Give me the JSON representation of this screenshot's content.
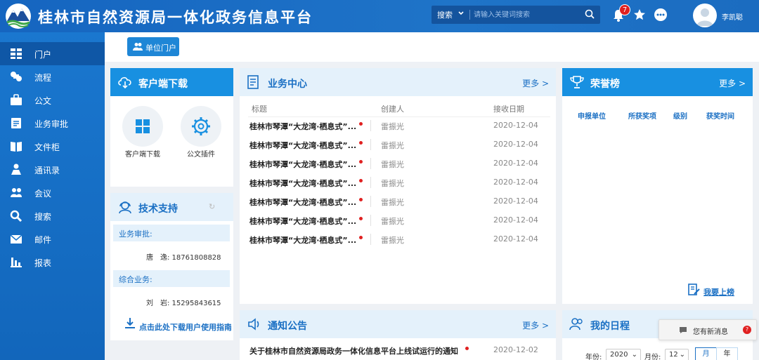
{
  "header": {
    "title": "桂林市自然资源局一体化政务信息平台",
    "search_type": "搜索",
    "search_placeholder": "请输入关键词搜索",
    "notification_count": "7",
    "user_name": "李凯聪"
  },
  "colors": {
    "header_bg": "#1a6fc4",
    "sidebar_bg": "#1a77cf",
    "accent": "#1890e1",
    "badge_red": "#e02020"
  },
  "sidebar": {
    "items": [
      {
        "label": "门户",
        "icon": "grid-icon"
      },
      {
        "label": "流程",
        "icon": "flow-icon"
      },
      {
        "label": "公文",
        "icon": "briefcase-icon"
      },
      {
        "label": "业务审批",
        "icon": "clipboard-icon"
      },
      {
        "label": "文件柜",
        "icon": "book-icon"
      },
      {
        "label": "通讯录",
        "icon": "contact-icon"
      },
      {
        "label": "会议",
        "icon": "meeting-icon"
      },
      {
        "label": "搜索",
        "icon": "search-icon"
      },
      {
        "label": "邮件",
        "icon": "mail-icon"
      },
      {
        "label": "报表",
        "icon": "chart-icon"
      }
    ]
  },
  "action_bar": {
    "unit_portal_label": "单位门户"
  },
  "download_card": {
    "title": "客户端下载",
    "items": [
      {
        "label": "客户端下载",
        "icon": "windows-icon"
      },
      {
        "label": "公文插件",
        "icon": "gear-icon"
      }
    ]
  },
  "support_card": {
    "title": "技术支持",
    "sections": [
      {
        "heading": "业务审批:",
        "contact": "唐　逸: 18761808828"
      },
      {
        "heading": "综合业务:",
        "contact": "刘　岩: 15295843615"
      }
    ],
    "manual_link": "点击此处下载用户使用指南"
  },
  "business_center": {
    "title": "业务中心",
    "more": "更多 >",
    "columns": [
      "标题",
      "创建人",
      "接收日期"
    ],
    "rows": [
      {
        "title": "桂林市琴潭“大龙湾·栖息式”...",
        "creator": "雷振光",
        "date": "2020-12-04"
      },
      {
        "title": "桂林市琴潭“大龙湾·栖息式”...",
        "creator": "雷振光",
        "date": "2020-12-04"
      },
      {
        "title": "桂林市琴潭“大龙湾·栖息式”...",
        "creator": "雷振光",
        "date": "2020-12-04"
      },
      {
        "title": "桂林市琴潭“大龙湾·栖息式”...",
        "creator": "雷振光",
        "date": "2020-12-04"
      },
      {
        "title": "桂林市琴潭“大龙湾·栖息式”...",
        "creator": "雷振光",
        "date": "2020-12-04"
      },
      {
        "title": "桂林市琴潭“大龙湾·栖息式”...",
        "creator": "雷振光",
        "date": "2020-12-04"
      },
      {
        "title": "桂林市琴潭“大龙湾·栖息式”...",
        "creator": "雷振光",
        "date": "2020-12-04"
      }
    ]
  },
  "honor_board": {
    "title": "荣誉榜",
    "more": "更多 >",
    "columns": [
      "申报单位",
      "所获奖项",
      "级别",
      "获奖时间"
    ],
    "upload_label": "我要上榜"
  },
  "notice": {
    "title": "通知公告",
    "more": "更多 >",
    "items": [
      {
        "title": "关于桂林市自然资源局政务一体化信息平台上线试运行的通知",
        "date": "2020-12-02"
      }
    ]
  },
  "schedule": {
    "title": "我的日程",
    "year_label": "年份:",
    "year_value": "2020",
    "month_label": "月份:",
    "month_value": "12",
    "view_month": "月",
    "view_year": "年"
  },
  "toast": {
    "message": "您有新消息",
    "count": "?"
  }
}
